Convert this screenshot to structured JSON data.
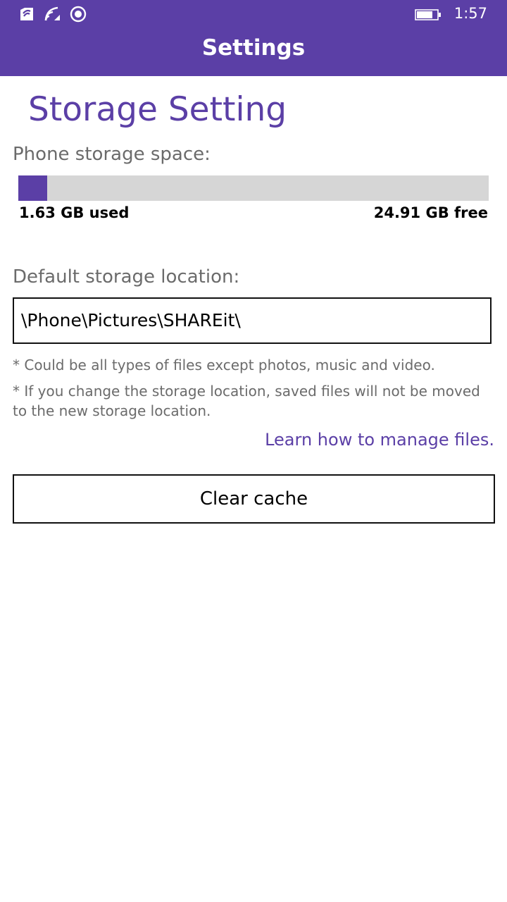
{
  "status_bar": {
    "time": "1:57",
    "icons": [
      "nfc-icon",
      "wifi-icon",
      "location-icon",
      "battery-icon"
    ]
  },
  "header": {
    "title": "Settings"
  },
  "storage": {
    "title": "Storage Setting",
    "space_label": "Phone storage space:",
    "used_label": "1.63 GB used",
    "free_label": "24.91 GB free",
    "used_fraction": 0.0614
  },
  "location": {
    "label": "Default storage location:",
    "path": "\\Phone\\Pictures\\SHAREit\\"
  },
  "notes": {
    "note_1": "*  Could be all types of files except photos, music and video.",
    "note_2": "*  If you change the storage location, saved files will not be moved to the new storage location."
  },
  "links": {
    "learn": "Learn how to manage files."
  },
  "actions": {
    "clear_cache": "Clear cache"
  },
  "colors": {
    "accent": "#5b3fa6",
    "bar_bg": "#d6d6d6"
  }
}
